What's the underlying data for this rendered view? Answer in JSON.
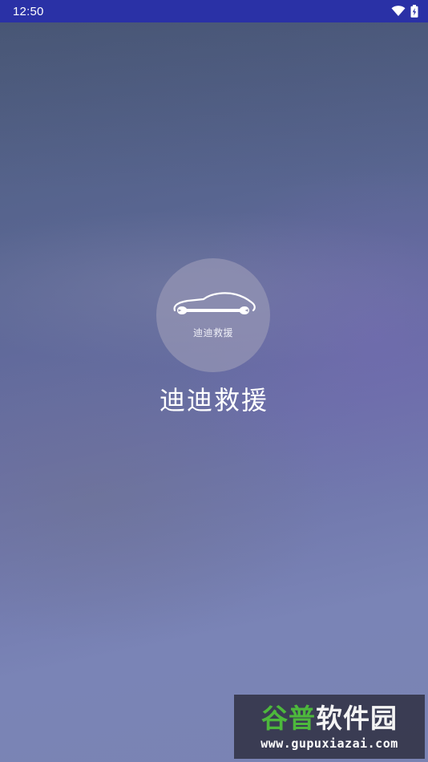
{
  "status_bar": {
    "time": "12:50",
    "icons": [
      "wifi-icon",
      "battery-charging-icon"
    ],
    "background": "#2a31a6"
  },
  "splash": {
    "logo_text": "迪迪救援",
    "title": "迪迪救援",
    "logo_icon": "car-wrench-icon"
  },
  "watermark": {
    "brand_part1": "谷普",
    "brand_part2": "软件园",
    "url": "www.gupuxiazai.com",
    "brand_color": "#4db83c"
  }
}
